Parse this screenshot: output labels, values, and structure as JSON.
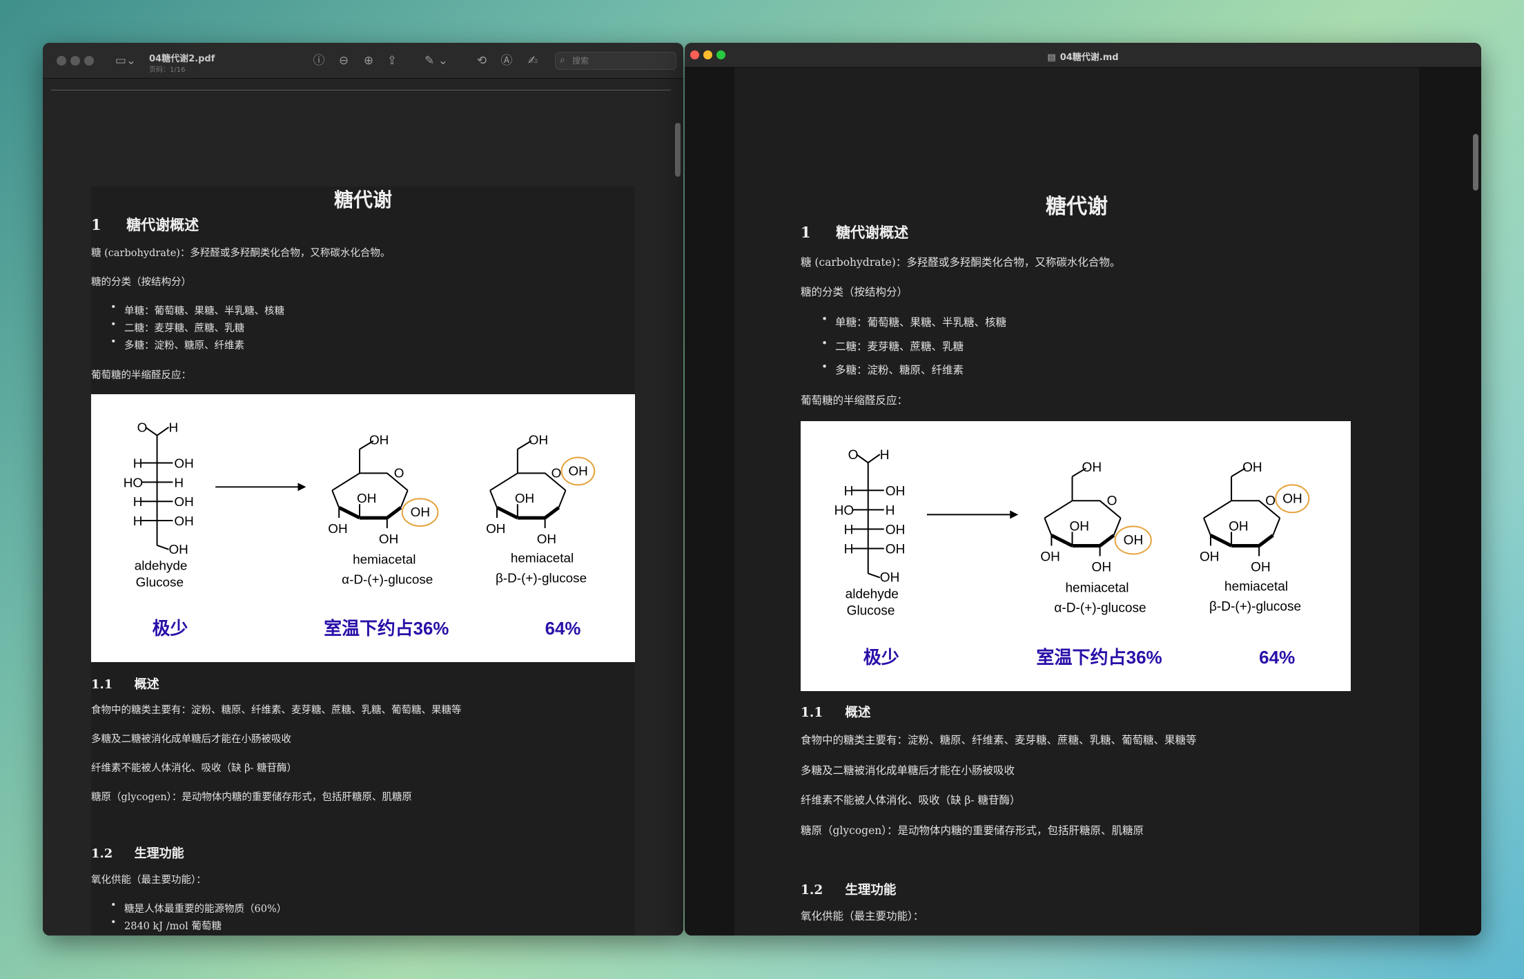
{
  "left_window": {
    "doc_title": "04糖代谢2.pdf",
    "doc_sub": "页码：1/16",
    "search_placeholder": "搜索",
    "icons": [
      "sidebar-icon",
      "info-icon",
      "zoom-out-icon",
      "zoom-in-icon",
      "share-icon",
      "markup-icon",
      "rotate-icon",
      "annotate-icon",
      "signature-icon",
      "search-icon"
    ]
  },
  "right_window": {
    "doc_title": "04糖代谢.md"
  },
  "doc": {
    "title": "糖代谢",
    "s1": "1     糖代谢概述",
    "p1": "糖 (carbohydrate)：多羟醛或多羟酮类化合物，又称碳水化合物。",
    "p2": "糖的分类（按结构分）",
    "list1": [
      "单糖：葡萄糖、果糖、半乳糖、核糖",
      "二糖：麦芽糖、蔗糖、乳糖",
      "多糖：淀粉、糖原、纤维素"
    ],
    "p3": "葡萄糖的半缩醛反应：",
    "figure": {
      "aldehyde": "aldehyde",
      "glucose": "Glucose",
      "hemi1": "hemiacetal",
      "alpha": "α-D-(+)-glucose",
      "hemi2": "hemiacetal",
      "beta": "β-D-(+)-glucose",
      "cap1": "极少",
      "cap2": "室温下约占36%",
      "cap3": "64%"
    },
    "s11": "1.1     概述",
    "p4": "食物中的糖类主要有：淀粉、糖原、纤维素、麦芽糖、蔗糖、乳糖、葡萄糖、果糖等",
    "p5": "多糖及二糖被消化成单糖后才能在小肠被吸收",
    "p6": "纤维素不能被人体消化、吸收（缺 β- 糖苷酶）",
    "p7": "糖原（glycogen）：是动物体内糖的重要储存形式，包括肝糖原、肌糖原",
    "s12": "1.2     生理功能",
    "p8": "氧化供能（最主要功能）：",
    "list2": [
      "糖是人体最重要的能源物质（60%）",
      "2840 kJ /mol 葡萄糖"
    ]
  }
}
